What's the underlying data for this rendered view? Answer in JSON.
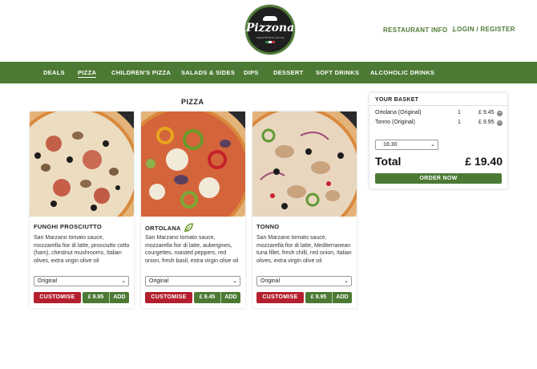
{
  "header": {
    "logo": {
      "brand": "Pizzona",
      "tagline": "napoletana pizza"
    },
    "restaurant_info": "RESTAURANT INFO",
    "login": "LOGIN / REGISTER"
  },
  "categories": [
    {
      "label": "DEALS",
      "active": false
    },
    {
      "label": "PIZZA",
      "active": true
    },
    {
      "label": "CHILDREN'S PIZZA",
      "active": false
    },
    {
      "label": "SALADS & SIDES",
      "active": false
    },
    {
      "label": "DIPS",
      "active": false
    },
    {
      "label": "DESSERT",
      "active": false
    },
    {
      "label": "SOFT DRINKS",
      "active": false
    },
    {
      "label": "ALCOHOLIC DRINKS",
      "active": false
    }
  ],
  "section_title": "PIZZA",
  "products": [
    {
      "name": "FUNGHI PROSCIUTTO",
      "vegetarian": false,
      "description": "San Marzano tomato sauce, mozzarella fior di latte, prosciutto cotto (ham), chestnut mushrooms, Italian olives, extra virgin olive oil",
      "option": "Original",
      "customise": "CUSTOMISE",
      "price": "£ 9.95",
      "add": "ADD"
    },
    {
      "name": "ORTOLANA",
      "vegetarian": true,
      "description": "San Marzano tomato sauce, mozzarella fior di latte, aubergines, courgettes, roasted peppers, red onion, fresh basil, extra virgin olive oil",
      "option": "Original",
      "customise": "CUSTOMISE",
      "price": "£ 9.45",
      "add": "ADD"
    },
    {
      "name": "TONNO",
      "vegetarian": false,
      "description": "San Marzano tomato sauce, mozzarella fior di latte, Mediterranean tuna fillet, fresh chilli, red onion, Italian olives, extra virgin olive oil",
      "option": "Original",
      "customise": "CUSTOMISE",
      "price": "£ 9.95",
      "add": "ADD"
    }
  ],
  "basket": {
    "title": "YOUR BASKET",
    "items": [
      {
        "name": "Ortolana (Original)",
        "qty": "1",
        "price": "£ 9.45"
      },
      {
        "name": "Tonno (Original)",
        "qty": "1",
        "price": "£ 9.95"
      }
    ],
    "time": "16:30",
    "total_label": "Total",
    "total_value": "£ 19.40",
    "order_now": "ORDER NOW"
  },
  "colors": {
    "brand_green": "#4c7a34",
    "customise_red": "#b5202e"
  },
  "icons": [
    "chef-hat-icon",
    "chevron-down-icon",
    "leaf-icon",
    "remove-icon"
  ]
}
